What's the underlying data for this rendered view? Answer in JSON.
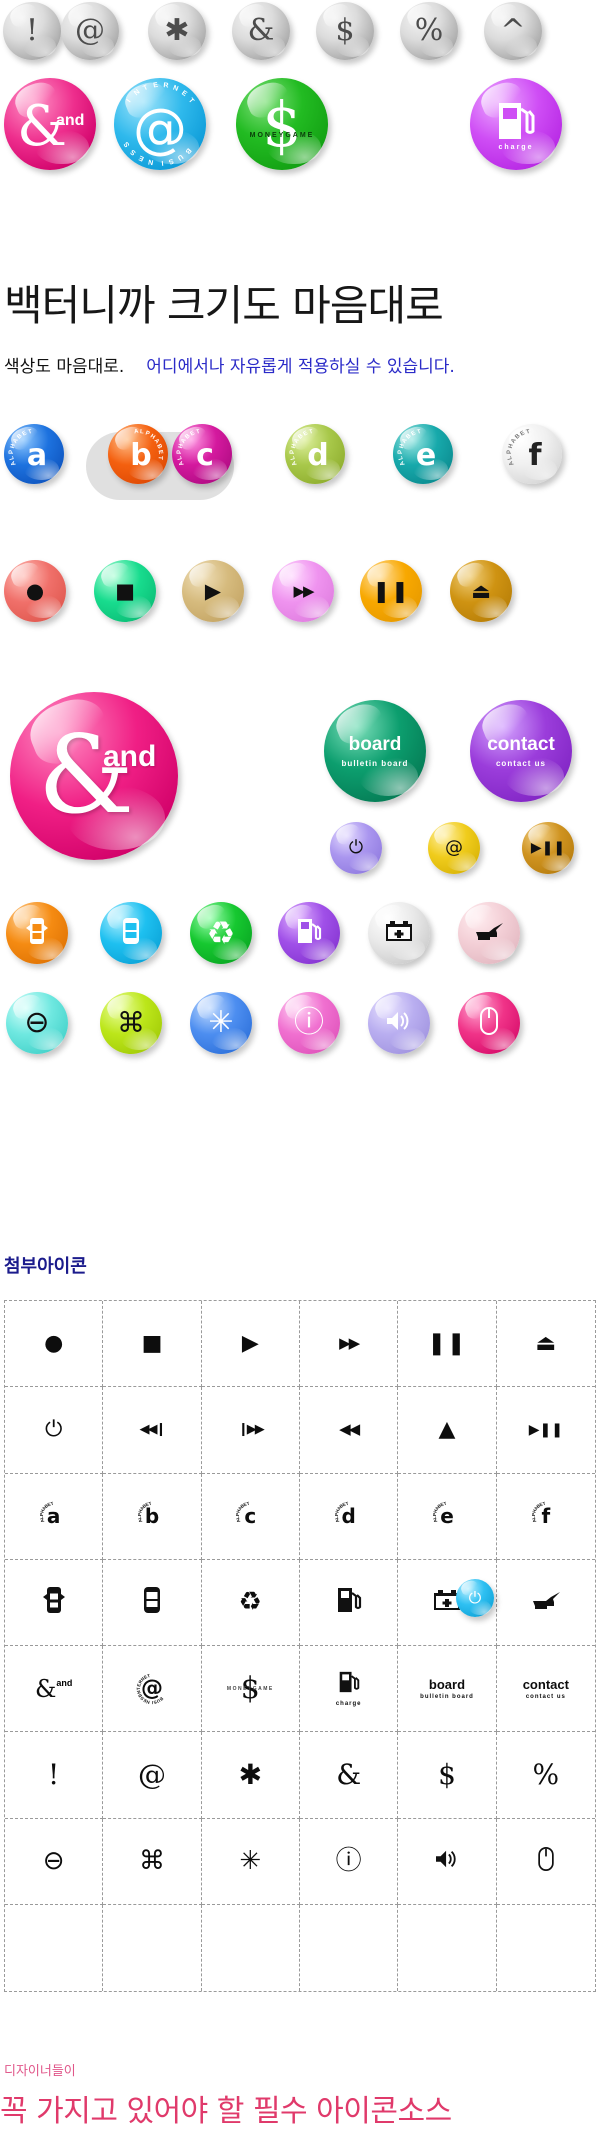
{
  "headline": "백터니까 크기도 마음대로",
  "subline": {
    "part1": "색상도 마음대로.",
    "part2": "어디에서나 자유롭게 적용하실 수 있습니다."
  },
  "section_label": "첨부아이콘",
  "footer": {
    "line1": "디자이너들이",
    "line2": "꼭 가지고 있어야 할 필수 아이콘소스"
  },
  "colors": {
    "headline": "#171717",
    "subline_accent": "#2b2bc8",
    "section_label": "#1b1b8c",
    "footer_small": "#e0578a",
    "footer_large": "#e03a6b",
    "grid_border": "#9a9a9a"
  },
  "grey_row": [
    {
      "name": "exclamation-button",
      "glyph": "!"
    },
    {
      "name": "at-button",
      "glyph": "@"
    },
    {
      "name": "asterisk-button",
      "glyph": "✱"
    },
    {
      "name": "ampersand-button",
      "glyph": "&"
    },
    {
      "name": "dollar-button",
      "glyph": "$"
    },
    {
      "name": "percent-button",
      "glyph": "%"
    },
    {
      "name": "caret-button",
      "glyph": "^"
    }
  ],
  "theme_row": [
    {
      "name": "and-button",
      "glyph": "&",
      "label": "and",
      "ring": "",
      "color": "#ee2e8d"
    },
    {
      "name": "internet-button",
      "glyph": "@",
      "ring": "INTERNET",
      "ring2": "BUSINESS",
      "color": "#2fb9ec"
    },
    {
      "name": "moneygame-button",
      "glyph": "$",
      "label": "MONEYGAME",
      "color": "#22bb22"
    },
    {
      "name": "fuel-charge-button",
      "glyph": "fuel-pump",
      "label": "charge",
      "color": "#cf4ef5"
    }
  ],
  "alphabet_row": [
    {
      "name": "alphabet-a-button",
      "letter": "a",
      "ring": "ALPHABET",
      "color": "#1d72df"
    },
    {
      "name": "alphabet-b-button",
      "letter": "b",
      "ring": "ALPHABET",
      "color": "#f4600f"
    },
    {
      "name": "alphabet-c-button",
      "letter": "c",
      "ring": "ALPHABET",
      "color": "#d4199e"
    },
    {
      "name": "alphabet-d-button",
      "letter": "d",
      "ring": "ALPHABET",
      "color": "#a8c84a"
    },
    {
      "name": "alphabet-e-button",
      "letter": "e",
      "ring": "ALPHABET",
      "color": "#17a9ab"
    },
    {
      "name": "alphabet-f-button",
      "letter": "f",
      "ring": "ALPHABET",
      "color": "#f0f0f0"
    }
  ],
  "media_row": [
    {
      "name": "record-button",
      "glyph": "●",
      "color": "#f0706a"
    },
    {
      "name": "stop-button",
      "glyph": "■",
      "color": "#18dc8e"
    },
    {
      "name": "play-button",
      "glyph": "▶",
      "color": "#d6bb7e"
    },
    {
      "name": "fast-forward-button",
      "glyph": "▶▶",
      "color": "#ef93ef"
    },
    {
      "name": "pause-button",
      "glyph": "❚❚",
      "color": "#f8a800"
    },
    {
      "name": "eject-button",
      "glyph": "⏏",
      "color": "#cf9312"
    }
  ],
  "feature_buttons": {
    "big_and": {
      "name": "big-and-button",
      "glyph": "&",
      "label": "and",
      "color": "#f01f85"
    },
    "board": {
      "name": "board-button",
      "label": "board",
      "sublabel": "bulletin board",
      "color": "#0c9e6e"
    },
    "contact": {
      "name": "contact-button",
      "label": "contact",
      "sublabel": "contact us",
      "color": "#9b3ddb"
    }
  },
  "small_row": [
    {
      "name": "power-button",
      "glyph": "⏻",
      "color": "#aa96ef"
    },
    {
      "name": "at-small-button",
      "glyph": "@",
      "color": "#f0cc1c"
    },
    {
      "name": "play-pause-button",
      "glyph": "▶❚❚",
      "color": "#cf9320"
    }
  ],
  "icon_row_a": [
    {
      "name": "car-front-button",
      "glyph": "car-front",
      "color": "#f58b12"
    },
    {
      "name": "car-top-button",
      "glyph": "car-top",
      "color": "#1ec0f0"
    },
    {
      "name": "recycle-button",
      "glyph": "♻",
      "color": "#16c830"
    },
    {
      "name": "fuel-pump-button",
      "glyph": "fuel-pump",
      "color": "#a050e8"
    },
    {
      "name": "battery-button",
      "glyph": "battery",
      "color": "#e9e9e9"
    },
    {
      "name": "oil-can-button",
      "glyph": "oil-can",
      "color": "#f3cfd6"
    }
  ],
  "icon_row_b": [
    {
      "name": "minus-circle-button",
      "glyph": "⊖",
      "color": "#6fe8e0"
    },
    {
      "name": "command-button",
      "glyph": "⌘",
      "color": "#bce61a"
    },
    {
      "name": "snowflake-button",
      "glyph": "✳",
      "color": "#4d8ef0"
    },
    {
      "name": "info-button",
      "glyph": "ⓘ",
      "color": "#f070d0"
    },
    {
      "name": "speaker-button",
      "glyph": "🔊",
      "color": "#b9aef0"
    },
    {
      "name": "mouse-button",
      "glyph": "mouse",
      "color": "#f03388"
    }
  ],
  "grid_icons": [
    {
      "name": "record-icon",
      "glyph": "●",
      "style": "plain"
    },
    {
      "name": "stop-icon",
      "glyph": "■",
      "style": "plain"
    },
    {
      "name": "play-icon",
      "glyph": "▶",
      "style": "plain"
    },
    {
      "name": "fast-forward-icon",
      "glyph": "▶▶",
      "style": "plain"
    },
    {
      "name": "pause-icon",
      "glyph": "❚❚",
      "style": "plain"
    },
    {
      "name": "eject-icon",
      "glyph": "⏏",
      "style": "plain"
    },
    {
      "name": "power-icon",
      "glyph": "⏻",
      "style": "plain"
    },
    {
      "name": "skip-back-icon",
      "glyph": "◀◀❙",
      "style": "plain"
    },
    {
      "name": "skip-forward-icon",
      "glyph": "❙▶▶",
      "style": "plain"
    },
    {
      "name": "rewind-icon",
      "glyph": "◀◀",
      "style": "plain"
    },
    {
      "name": "up-triangle-icon",
      "glyph": "▲",
      "style": "plain"
    },
    {
      "name": "play-pause-icon",
      "glyph": "▶❚❚",
      "style": "plain"
    },
    {
      "name": "alphabet-a-icon",
      "glyph": "a",
      "style": "ring",
      "ring": "ALPHABET"
    },
    {
      "name": "alphabet-b-icon",
      "glyph": "b",
      "style": "ring",
      "ring": "ALPHABET"
    },
    {
      "name": "alphabet-c-icon",
      "glyph": "c",
      "style": "ring",
      "ring": "ALPHABET"
    },
    {
      "name": "alphabet-d-icon",
      "glyph": "d",
      "style": "ring",
      "ring": "ALPHABET"
    },
    {
      "name": "alphabet-e-icon",
      "glyph": "e",
      "style": "ring",
      "ring": "ALPHABET"
    },
    {
      "name": "alphabet-f-icon",
      "glyph": "f",
      "style": "ring",
      "ring": "ALPHABET"
    },
    {
      "name": "car-front-icon",
      "glyph": "car-front",
      "style": "svg"
    },
    {
      "name": "car-top-icon",
      "glyph": "car-top",
      "style": "svg"
    },
    {
      "name": "recycle-icon",
      "glyph": "♻",
      "style": "plain"
    },
    {
      "name": "fuel-pump-icon",
      "glyph": "fuel-pump",
      "style": "svg"
    },
    {
      "name": "battery-icon",
      "glyph": "battery",
      "style": "svg"
    },
    {
      "name": "oil-can-icon",
      "glyph": "oil-can",
      "style": "svg"
    },
    {
      "name": "and-icon",
      "glyph": "&",
      "style": "label",
      "label": "and"
    },
    {
      "name": "internet-at-icon",
      "glyph": "@",
      "style": "ring",
      "ring": "INTERNET"
    },
    {
      "name": "moneygame-dollar-icon",
      "glyph": "$",
      "style": "label",
      "label": "MONEYGAME"
    },
    {
      "name": "fuel-charge-icon",
      "glyph": "fuel-pump",
      "style": "svg",
      "label": "charge"
    },
    {
      "name": "board-icon",
      "glyph": "board",
      "style": "text",
      "label": "board",
      "sublabel": "bulletin board"
    },
    {
      "name": "contact-icon",
      "glyph": "contact",
      "style": "text",
      "label": "contact",
      "sublabel": "contact us"
    },
    {
      "name": "exclamation-icon",
      "glyph": "!",
      "style": "serif"
    },
    {
      "name": "at-icon",
      "glyph": "@",
      "style": "serif"
    },
    {
      "name": "asterisk-icon",
      "glyph": "✱",
      "style": "serif"
    },
    {
      "name": "ampersand-icon",
      "glyph": "&",
      "style": "serif"
    },
    {
      "name": "dollar-icon",
      "glyph": "$",
      "style": "serif"
    },
    {
      "name": "percent-icon",
      "glyph": "%",
      "style": "serif"
    },
    {
      "name": "minus-circle-icon",
      "glyph": "⊖",
      "style": "plain"
    },
    {
      "name": "command-icon",
      "glyph": "⌘",
      "style": "plain"
    },
    {
      "name": "snowflake-icon",
      "glyph": "✳",
      "style": "plain"
    },
    {
      "name": "info-icon",
      "glyph": "ⓘ",
      "style": "plain"
    },
    {
      "name": "speaker-icon",
      "glyph": "🔊",
      "style": "plain"
    },
    {
      "name": "mouse-icon",
      "glyph": "mouse",
      "style": "svg"
    }
  ],
  "float_power_button": {
    "name": "floating-power-button",
    "glyph": "⏻",
    "color": "#2ec0f2"
  }
}
